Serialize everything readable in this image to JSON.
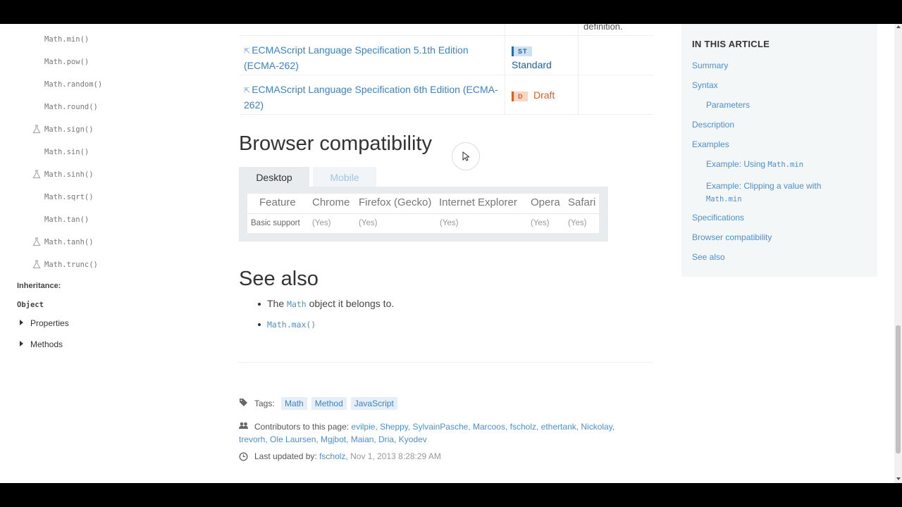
{
  "sidebar": {
    "items": [
      {
        "label": "Math.min()",
        "experimental": false
      },
      {
        "label": "Math.pow()",
        "experimental": false
      },
      {
        "label": "Math.random()",
        "experimental": false
      },
      {
        "label": "Math.round()",
        "experimental": false
      },
      {
        "label": "Math.sign()",
        "experimental": true
      },
      {
        "label": "Math.sin()",
        "experimental": false
      },
      {
        "label": "Math.sinh()",
        "experimental": true
      },
      {
        "label": "Math.sqrt()",
        "experimental": false
      },
      {
        "label": "Math.tan()",
        "experimental": false
      },
      {
        "label": "Math.tanh()",
        "experimental": true
      },
      {
        "label": "Math.trunc()",
        "experimental": true
      }
    ],
    "inheritance_label": "Inheritance:",
    "object_label": "Object",
    "properties_label": "Properties",
    "methods_label": "Methods"
  },
  "spec_table": {
    "top_row_comment": "definition.",
    "rows": [
      {
        "line1": "ECMAScript Language Specification 5.1th Edition",
        "line2": "(ECMA-262)",
        "badge": "ST",
        "status": "Standard"
      },
      {
        "line1": "ECMAScript Language Specification 6th Edition (ECMA-",
        "line2": "262)",
        "badge": "D",
        "status": "Draft"
      }
    ]
  },
  "compat": {
    "heading": "Browser compatibility",
    "tabs": [
      "Desktop",
      "Mobile"
    ],
    "headers": [
      "Feature",
      "Chrome",
      "Firefox (Gecko)",
      "Internet Explorer",
      "Opera",
      "Safari"
    ],
    "row": [
      "Basic support",
      "(Yes)",
      "(Yes)",
      "(Yes)",
      "(Yes)",
      "(Yes)"
    ]
  },
  "see_also": {
    "heading": "See also",
    "item1_pre": "The",
    "item1_code": "Math",
    "item1_post": "object it belongs to.",
    "item2_code": "Math.max()"
  },
  "footer": {
    "tags_label": "Tags:",
    "tags": [
      "Math",
      "Method",
      "JavaScript"
    ],
    "contributors_label": "Contributors to this page:",
    "contributors_line1": "evilpie, Sheppy, SylvainPasche, Marcoos, fscholz, ethertank, Nickolay,",
    "contributors_line2": "trevorh, Ole Laursen, Mgjbot, Maian, Dria, Kyodev",
    "updated_label": "Last updated by:",
    "updated_by": "fscholz,",
    "updated_date": "Nov 1, 2013 8:28:29 AM"
  },
  "toc": {
    "heading": "IN THIS ARTICLE",
    "summary": "Summary",
    "syntax": "Syntax",
    "parameters": "Parameters",
    "description": "Description",
    "examples": "Examples",
    "ex1_text": "Example: Using",
    "ex1_code": "Math.min",
    "ex2_text": "Example: Clipping a value with",
    "ex2_code": "Math.min",
    "specifications": "Specifications",
    "browser_compat": "Browser compatibility",
    "see_also": "See also"
  },
  "colors": {
    "link": "#3c82c4",
    "standard_badge": "#2b6aa8",
    "draft_badge": "#d5602c"
  }
}
